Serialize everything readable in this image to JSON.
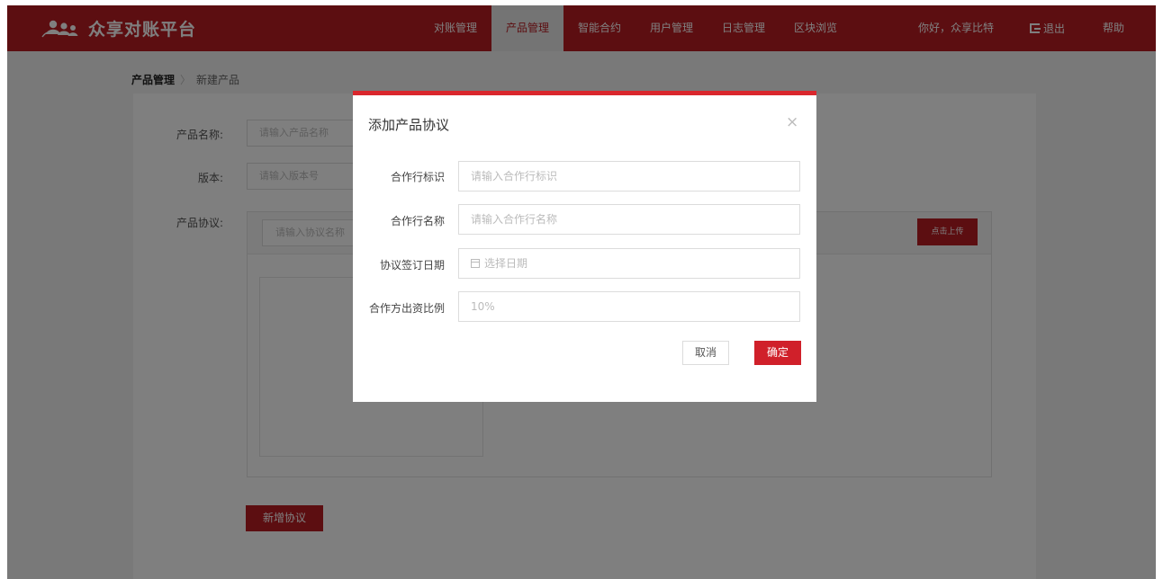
{
  "app": {
    "title": "众享对账平台",
    "brand_color": "#b81c22",
    "logo_icon": "users-icon"
  },
  "nav": {
    "items": [
      {
        "label": "对账管理",
        "active": false
      },
      {
        "label": "产品管理",
        "active": true
      },
      {
        "label": "智能合约",
        "active": false
      },
      {
        "label": "用户管理",
        "active": false
      },
      {
        "label": "日志管理",
        "active": false
      },
      {
        "label": "区块浏览",
        "active": false
      }
    ],
    "greeting": "你好，众享比特",
    "logout_label": "退出",
    "logout_icon": "logout-icon",
    "help_label": "帮助"
  },
  "breadcrumb": {
    "current": "产品管理",
    "separator": "〉",
    "page": "新建产品"
  },
  "form": {
    "product_name_label": "产品名称:",
    "product_name_placeholder": "请输入产品名称",
    "version_label": "版本:",
    "version_placeholder": "请输入版本号",
    "agreement_label": "产品协议:",
    "agreement_name_placeholder": "请输入协议名称",
    "upload_label": "点击上传",
    "add_agreement_label": "新增协议"
  },
  "modal": {
    "title": "添加产品协议",
    "close_icon": "close-icon",
    "fields": [
      {
        "label": "合作行标识",
        "placeholder": "请输入合作行标识"
      },
      {
        "label": "合作行名称",
        "placeholder": "请输入合作行名称"
      },
      {
        "label": "协议签订日期",
        "placeholder": "选择日期",
        "icon": "calendar-icon"
      },
      {
        "label": "合作方出资比例",
        "placeholder": "10%"
      }
    ],
    "cancel_label": "取消",
    "confirm_label": "确定",
    "accent_color": "#d9272d"
  }
}
